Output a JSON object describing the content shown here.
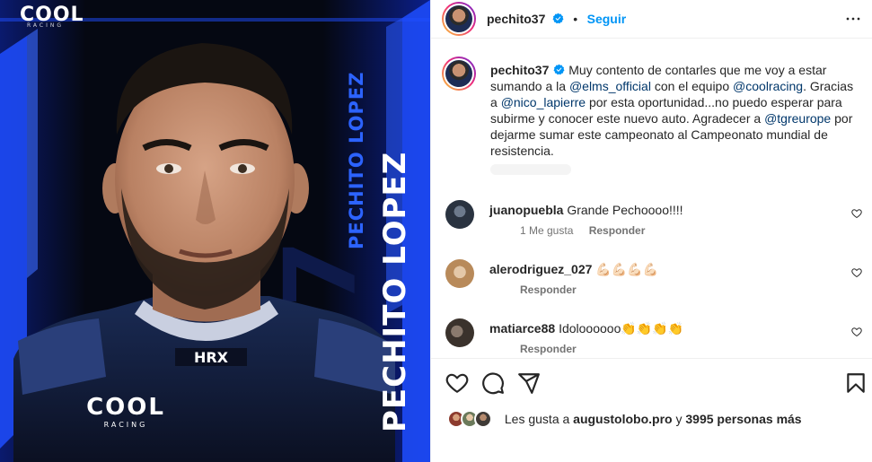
{
  "post": {
    "image": {
      "logo_text": "COOL",
      "logo_sub": "RACING",
      "name_big": "PECHITO LOPEZ",
      "name_small": "PECHITO LOPEZ",
      "suit_brand": "HRX",
      "chest_logo": "COOL",
      "chest_sub": "RACING",
      "colors": {
        "accent": "#1f4dff",
        "background": "#05070f"
      }
    },
    "header": {
      "username": "pechito37",
      "separator": "•",
      "follow_label": "Seguir",
      "more_icon": "more-horizontal-icon"
    },
    "caption": {
      "username": "pechito37",
      "segments": [
        {
          "text": "Muy contento de contarles que me voy a estar sumando a la ",
          "mention": false
        },
        {
          "text": "@elms_official",
          "mention": true
        },
        {
          "text": " con el equipo ",
          "mention": false
        },
        {
          "text": "@coolracing",
          "mention": true
        },
        {
          "text": ". Gracias a ",
          "mention": false
        },
        {
          "text": "@nico_lapierre",
          "mention": true
        },
        {
          "text": " por esta oportunidad...no puedo esperar para subirme y conocer este nuevo auto. Agradecer a ",
          "mention": false
        },
        {
          "text": "@tgreurope",
          "mention": true
        },
        {
          "text": " por dejarme sumar este campeonato al Campeonato mundial de resistencia.",
          "mention": false
        }
      ]
    },
    "comments": [
      {
        "username": "juanopuebla",
        "text": "Grande Pechoooo!!!!",
        "likes": "1 Me gusta",
        "reply": "Responder"
      },
      {
        "username": "alerodriguez_027",
        "text": "💪🏻💪🏻💪🏻💪🏻",
        "likes": "",
        "reply": "Responder"
      },
      {
        "username": "matiarce88",
        "text": "Idoloooooo👏👏👏👏",
        "likes": "",
        "reply": "Responder"
      }
    ],
    "actions": {
      "like_icon": "heart-icon",
      "comment_icon": "comment-icon",
      "share_icon": "share-icon",
      "save_icon": "bookmark-icon"
    },
    "likes_line": {
      "prefix": "Les gusta a ",
      "user": "augustolobo.pro",
      "middle": " y ",
      "count": "3995 personas más"
    }
  }
}
